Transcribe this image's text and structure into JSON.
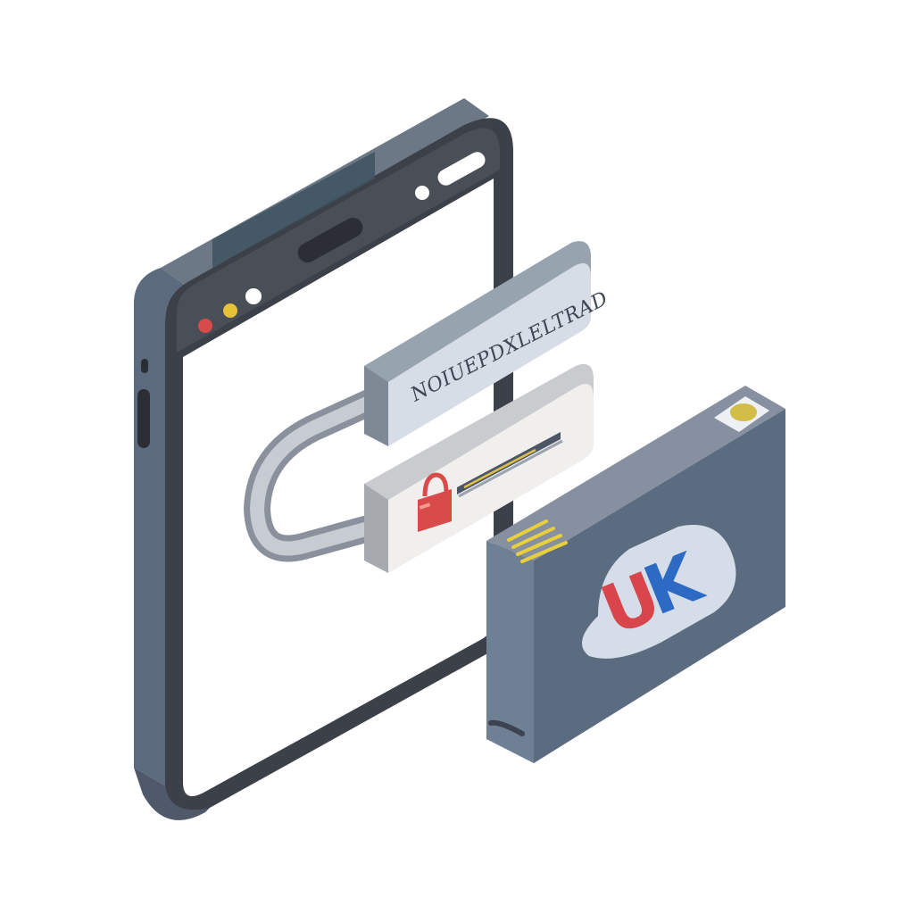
{
  "illustration": {
    "banner_text": "NOIUEPDXLELTRAD",
    "card_badge": {
      "letter_1": "U",
      "letter_2": "K"
    }
  },
  "window_controls": [
    "red-dot",
    "yellow-dot",
    "white-dot"
  ],
  "colors": {
    "device_frame": "#5b6a7d",
    "device_frame_dark": "#3c4049",
    "screen": "#ffffff",
    "banner": "#d6dde6",
    "lock_panel": "#f1efed",
    "lock_red": "#d94a4a",
    "card_body": "#5b6b80",
    "card_top": "#8790a0",
    "badge_bg": "#d5dee8",
    "badge_red": "#d8454a",
    "badge_blue": "#2d6ac4",
    "contacts_yellow": "#e8cf3c",
    "indicator_yellow": "#d2bd48"
  }
}
